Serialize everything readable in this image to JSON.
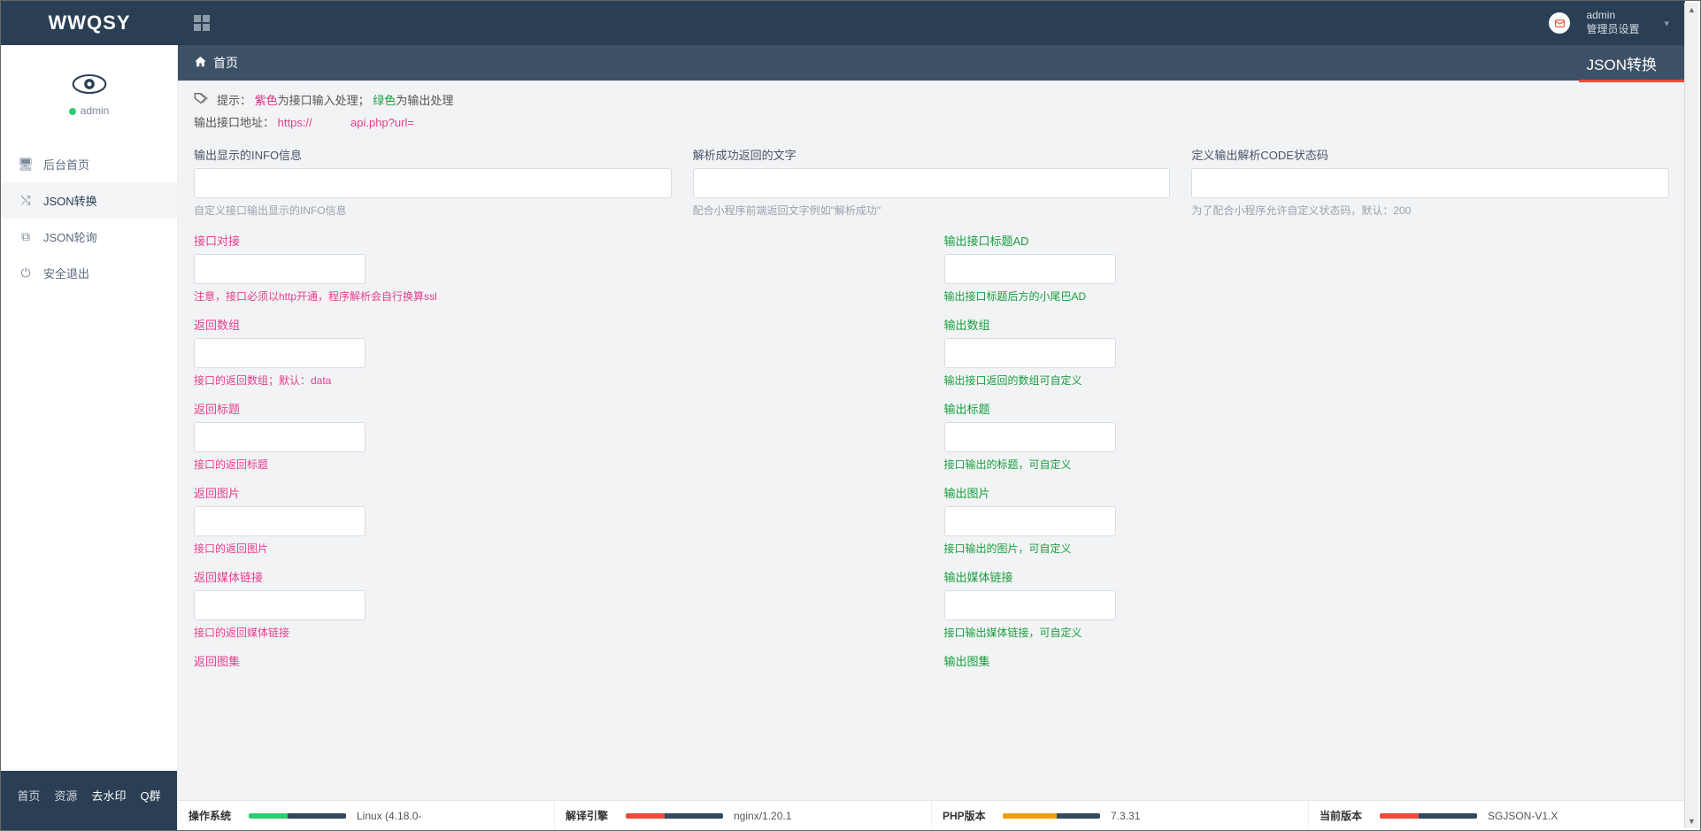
{
  "logo": "WWQSY",
  "header": {
    "username": "admin",
    "user_sub": "管理员设置"
  },
  "sidebar": {
    "username": "admin",
    "items": [
      {
        "label": "后台首页"
      },
      {
        "label": "JSON转换"
      },
      {
        "label": "JSON轮询"
      },
      {
        "label": "安全退出"
      }
    ],
    "footer_links": [
      "首页",
      "资源",
      "去水印",
      "Q群"
    ]
  },
  "breadcrumb": {
    "home": "首页",
    "page_title": "JSON转换"
  },
  "tips": {
    "prefix": "提示：",
    "purple_word": "紫色",
    "purple_desc": "为接口输入处理；",
    "green_word": "绿色",
    "green_desc": "为输出处理",
    "addr_label": "输出接口地址：",
    "addr_prefix": "https://",
    "addr_suffix": "api.php?url="
  },
  "top_fields": [
    {
      "label": "输出显示的INFO信息",
      "help": "自定义接口输出显示的INFO信息"
    },
    {
      "label": "解析成功返回的文字",
      "help": "配合小程序前端返回文字例如\"解析成功\""
    },
    {
      "label": "定义输出解析CODE状态码",
      "help": "为了配合小程序允许自定义状态码，默认：200"
    }
  ],
  "purple_fields": [
    {
      "label": "接口对接",
      "help": "注意，接口必须以http开通，程序解析会自行换算ssl"
    },
    {
      "label": "返回数组",
      "help": "接口的返回数组；默认：data"
    },
    {
      "label": "返回标题",
      "help": "接口的返回标题"
    },
    {
      "label": "返回图片",
      "help": "接口的返回图片"
    },
    {
      "label": "返回媒体链接",
      "help": "接口的返回媒体链接"
    },
    {
      "label": "返回图集",
      "help": ""
    }
  ],
  "green_fields": [
    {
      "label": "输出接口标题AD",
      "help": "输出接口标题后方的小尾巴AD"
    },
    {
      "label": "输出数组",
      "help": "输出接口返回的数组可自定义"
    },
    {
      "label": "输出标题",
      "help": "接口输出的标题，可自定义"
    },
    {
      "label": "输出图片",
      "help": "接口输出的图片，可自定义"
    },
    {
      "label": "输出媒体链接",
      "help": "接口输出媒体链接，可自定义"
    },
    {
      "label": "输出图集",
      "help": ""
    }
  ],
  "status": {
    "os": {
      "label": "操作系统",
      "value": "Linux (4.18.0-",
      "seg1_color": "#2ecc71",
      "seg1_w": 40,
      "seg2_color": "#34495e",
      "seg2_w": 60
    },
    "engine": {
      "label": "解译引擎",
      "value": "nginx/1.20.1",
      "seg1_color": "#e74c3c",
      "seg1_w": 40,
      "seg2_color": "#34495e",
      "seg2_w": 60
    },
    "php": {
      "label": "PHP版本",
      "value": "7.3.31",
      "seg1_color": "#f39c12",
      "seg1_w": 55,
      "seg2_color": "#34495e",
      "seg2_w": 45
    },
    "ver": {
      "label": "当前版本",
      "value": "SGJSON-V1.X",
      "seg1_color": "#e74c3c",
      "seg1_w": 40,
      "seg2_color": "#34495e",
      "seg2_w": 60
    }
  }
}
